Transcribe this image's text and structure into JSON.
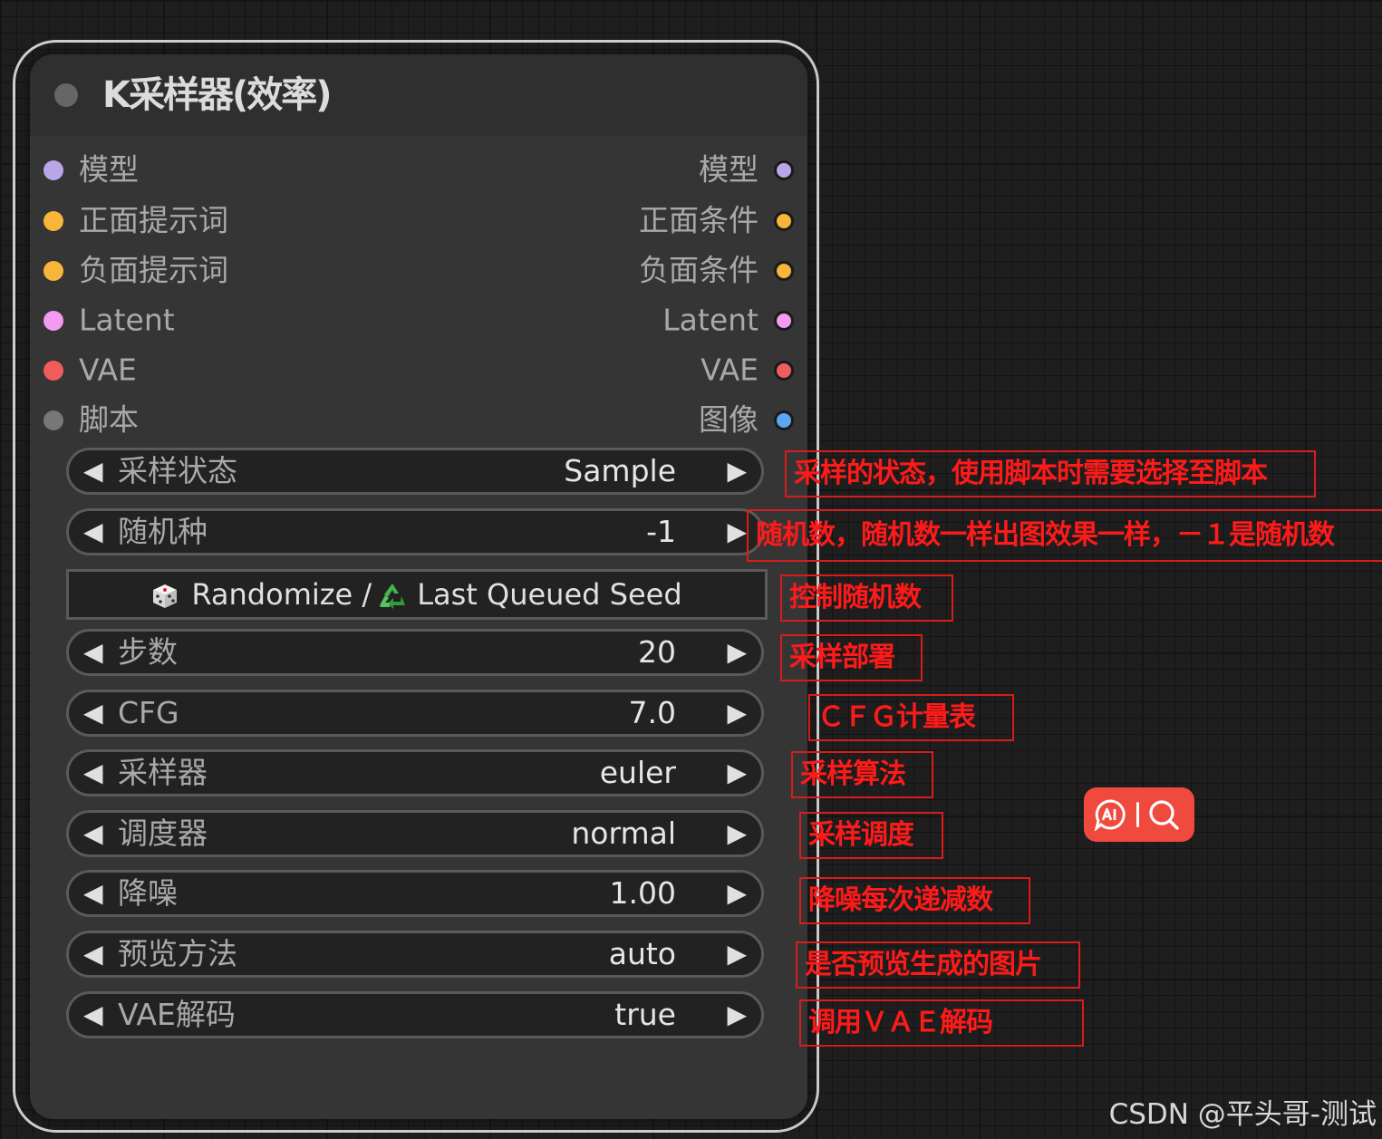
{
  "node": {
    "title": "K采样器(效率)",
    "inputs": [
      {
        "label": "模型",
        "color": "#b8a6e8"
      },
      {
        "label": "正面提示词",
        "color": "#f7b53a"
      },
      {
        "label": "负面提示词",
        "color": "#f7b53a"
      },
      {
        "label": "Latent",
        "color": "#f39bf0"
      },
      {
        "label": "VAE",
        "color": "#ef5c5c"
      },
      {
        "label": "脚本",
        "color": "#777777"
      }
    ],
    "outputs": [
      {
        "label": "模型",
        "color": "#b8a6e8"
      },
      {
        "label": "正面条件",
        "color": "#f7b53a"
      },
      {
        "label": "负面条件",
        "color": "#f7b53a"
      },
      {
        "label": "Latent",
        "color": "#f39bf0"
      },
      {
        "label": "VAE",
        "color": "#ef5c5c"
      },
      {
        "label": "图像",
        "color": "#5aa6f0"
      }
    ],
    "widgets": [
      {
        "label": "采样状态",
        "value": "Sample"
      },
      {
        "label": "随机种",
        "value": "-1"
      },
      {
        "label": "步数",
        "value": "20"
      },
      {
        "label": "CFG",
        "value": "7.0"
      },
      {
        "label": "采样器",
        "value": "euler"
      },
      {
        "label": "调度器",
        "value": "normal"
      },
      {
        "label": "降噪",
        "value": "1.00"
      },
      {
        "label": "预览方法",
        "value": "auto"
      },
      {
        "label": "VAE解码",
        "value": "true"
      }
    ],
    "seed_button": {
      "randomize": "Randomize /",
      "last": "Last Queued Seed"
    }
  },
  "annotations": [
    "采样的状态，使用脚本时需要选择至脚本",
    "随机数，随机数一样出图效果一样，－１是随机数",
    "控制随机数",
    "采样部署",
    "ＣＦＧ计量表",
    "采样算法",
    "采样调度",
    "降噪每次递减数",
    "是否预览生成的图片",
    "调用ＶＡＥ解码"
  ],
  "watermark": "CSDN @平头哥-测试",
  "colors": {
    "annotation": "#ff1a1a",
    "ai_tool": "#f04a3e"
  }
}
